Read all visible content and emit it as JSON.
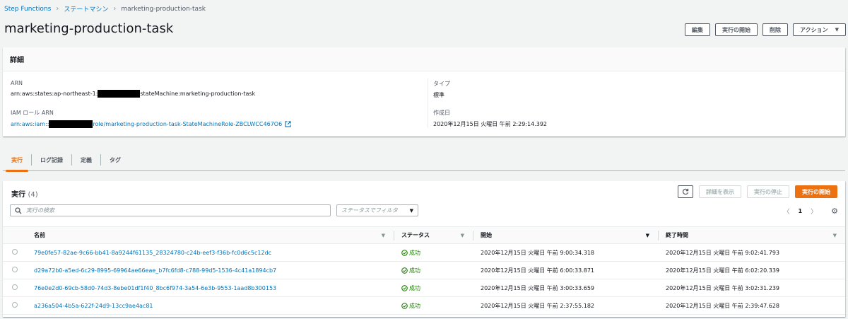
{
  "breadcrumb": {
    "root": "Step Functions",
    "parent": "ステートマシン",
    "current": "marketing-production-task"
  },
  "page_title": "marketing-production-task",
  "header_actions": {
    "edit": "編集",
    "start": "実行の開始",
    "delete": "削除",
    "actions": "アクション"
  },
  "details": {
    "heading": "詳細",
    "arn_label": "ARN",
    "arn_prefix": "arn:aws:states:ap-northeast-1:",
    "arn_suffix": "stateMachine:marketing-production-task",
    "iam_label": "IAM ロール ARN",
    "iam_prefix": "arn:aws:iam::",
    "iam_suffix": "role/marketing-production-task-StateMachineRole-ZBCLWCC467O6",
    "type_label": "タイプ",
    "type_value": "標準",
    "created_label": "作成日",
    "created_value": "2020年12月15日 火曜日 午前 2:29:14.392"
  },
  "tabs": [
    "実行",
    "ログ記録",
    "定義",
    "タグ"
  ],
  "executions": {
    "title": "実行",
    "count": "(4)",
    "btn_details": "詳細を表示",
    "btn_stop": "実行の停止",
    "btn_start": "実行の開始",
    "search_placeholder": "実行の検索",
    "filter_placeholder": "ステータスでフィルタ",
    "page": "1",
    "columns": [
      "名前",
      "ステータス",
      "開始",
      "終了時間"
    ],
    "rows": [
      {
        "name": "79e0fe57-82ae-9c66-bb41-8a9244f61135_28324780-c24b-eef3-f36b-fc0d6c5c12dc",
        "status": "成功",
        "start": "2020年12月15日 火曜日 午前 9:00:34.318",
        "end": "2020年12月15日 火曜日 午前 9:02:41.793"
      },
      {
        "name": "d29a72b0-a5ed-6c29-8995-69964ae66eae_b7fc6fd8-c788-99d5-1536-4c41a1894cb7",
        "status": "成功",
        "start": "2020年12月15日 火曜日 午前 6:00:33.871",
        "end": "2020年12月15日 火曜日 午前 6:02:20.339"
      },
      {
        "name": "76e0e2d0-69cb-58d0-74d3-8ebe01df1f40_8bc6f974-3a54-6e3b-9553-1aad8b300153",
        "status": "成功",
        "start": "2020年12月15日 火曜日 午前 3:00:33.659",
        "end": "2020年12月15日 火曜日 午前 3:02:31.239"
      },
      {
        "name": "a236a504-4b5a-622f-24d9-13cc9ae4ac81",
        "status": "成功",
        "start": "2020年12月15日 火曜日 午前 2:37:55.182",
        "end": "2020年12月15日 火曜日 午前 2:39:47.628"
      }
    ]
  },
  "colors": {
    "link": "#0073bb",
    "accent": "#ec7211",
    "success": "#1d8102"
  }
}
